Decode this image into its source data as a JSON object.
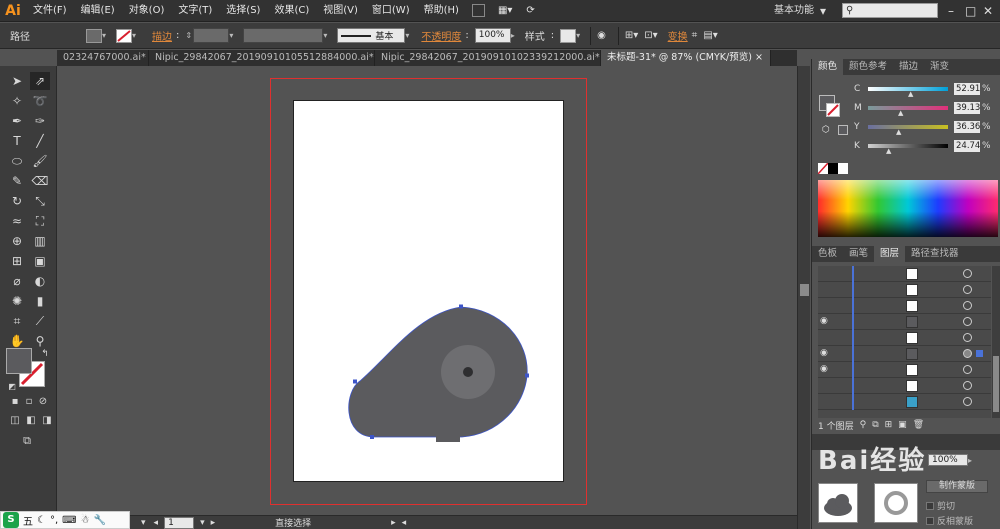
{
  "menubar": {
    "logo": "Ai",
    "items": [
      "文件(F)",
      "编辑(E)",
      "对象(O)",
      "文字(T)",
      "选择(S)",
      "效果(C)",
      "视图(V)",
      "窗口(W)",
      "帮助(H)"
    ],
    "workspace": "基本功能",
    "search_icon": "search-icon"
  },
  "control": {
    "object_type": "路径",
    "stroke_label": "描边",
    "stroke_style": "基本",
    "opacity_label": "不透明度",
    "opacity_value": "100%",
    "style_label": "样式",
    "transform_label": "变换"
  },
  "tabs": [
    "02324767000.ai*",
    "Nipic_29842067_20190910105512884000.ai*",
    "Nipic_29842067_20190910102339212000.ai*",
    "未标题-31* @ 87% (CMYK/预览)"
  ],
  "tab_close": "×",
  "color_panel": {
    "tabs": [
      "颜色",
      "颜色参考",
      "描边",
      "渐变"
    ],
    "channels": [
      {
        "letter": "C",
        "value": "52.91",
        "color": "#00a0d8"
      },
      {
        "letter": "M",
        "value": "39.13",
        "color": "#e0307a"
      },
      {
        "letter": "Y",
        "value": "36.36",
        "color": "#e8d400"
      },
      {
        "letter": "K",
        "value": "24.74",
        "color": "#000000"
      }
    ],
    "unit": "%"
  },
  "layers_panel": {
    "tabs": [
      "色板",
      "画笔",
      "图层",
      "路径查找器"
    ],
    "footer_count": "1 个图层"
  },
  "transparency": {
    "value": "100%",
    "make_mask_label": "制作蒙版",
    "clip_label": "剪切",
    "invert_label": "反相蒙版"
  },
  "status": {
    "zoom": "87%",
    "page": "1",
    "tool": "直接选择"
  },
  "shape": {
    "fill": "#5b5b5e",
    "inner_circle": "#6e6e71",
    "center_dot": "#2e2e30",
    "outline": "#3d55c8"
  },
  "watermark": "Bai经验",
  "taskbar": {
    "app": "S",
    "text": "五"
  }
}
